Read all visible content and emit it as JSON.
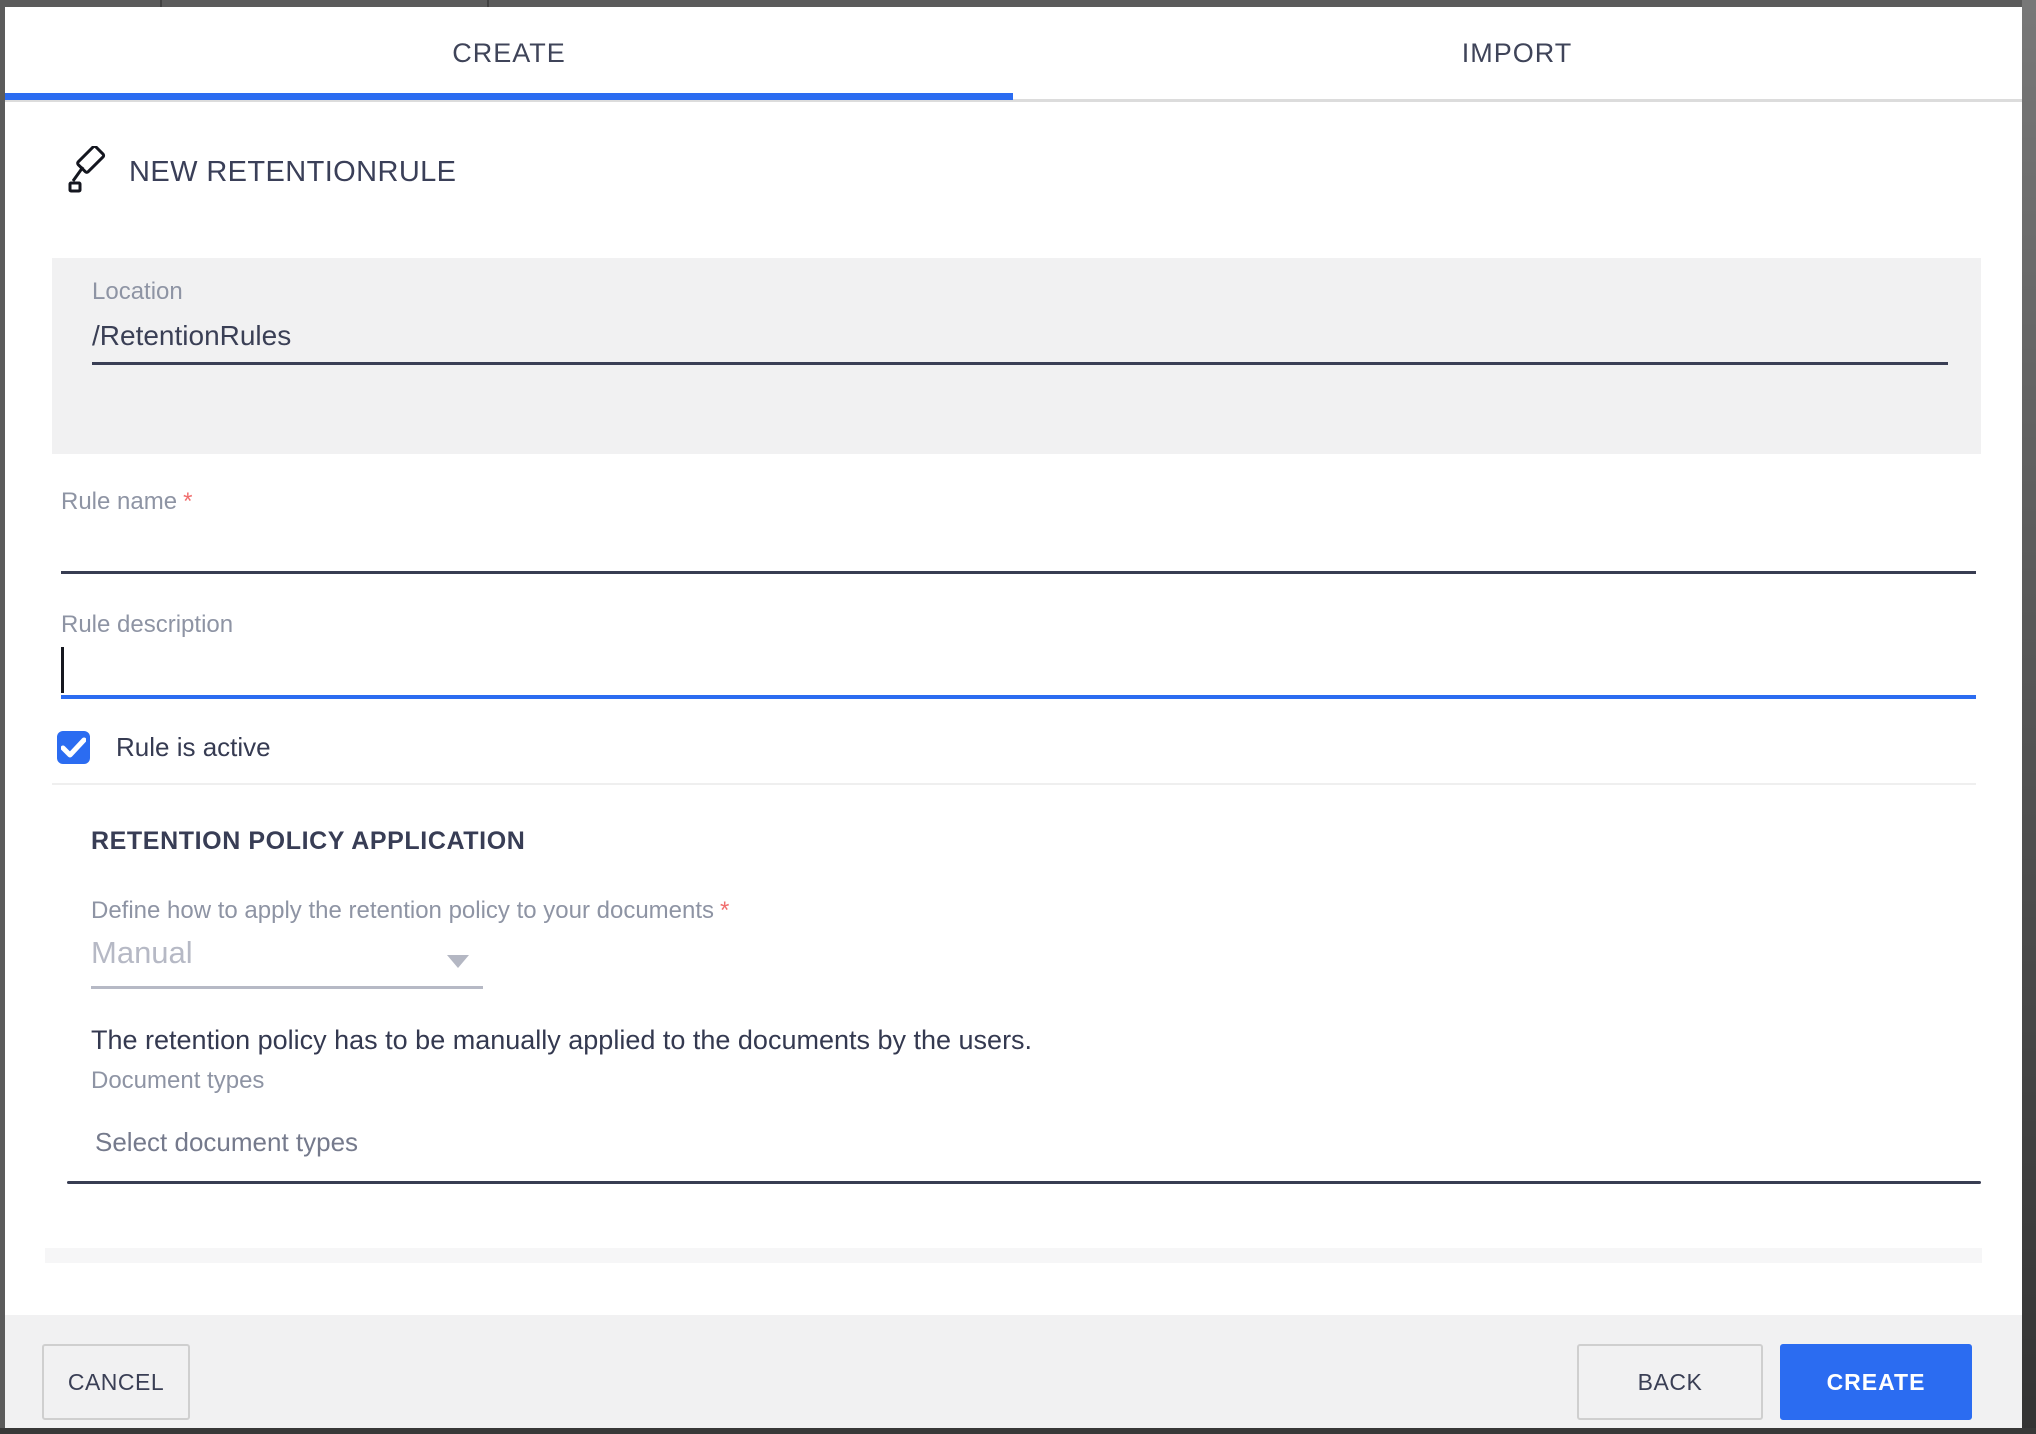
{
  "tabs": [
    {
      "label": "CREATE",
      "active": true
    },
    {
      "label": "IMPORT",
      "active": false
    }
  ],
  "header": {
    "title": "NEW RETENTIONRULE",
    "icon": "gavel-icon"
  },
  "location": {
    "label": "Location",
    "value": "/RetentionRules"
  },
  "fields": {
    "required_mark": "*",
    "rule_name": {
      "label": "Rule name",
      "required": true,
      "value": ""
    },
    "rule_description": {
      "label": "Rule description",
      "value": "",
      "focused": true
    },
    "rule_active": {
      "label": "Rule is active",
      "checked": true
    }
  },
  "retention_section": {
    "title": "RETENTION POLICY APPLICATION",
    "apply_label": "Define how to apply the retention policy to your documents",
    "apply_required": true,
    "apply_value": "Manual",
    "apply_disabled": true,
    "apply_hint": "The retention policy has to be manually applied to the documents by the users.",
    "document_types_label": "Document types",
    "document_types_placeholder": "Select document types"
  },
  "footer": {
    "cancel_label": "CANCEL",
    "back_label": "BACK",
    "create_label": "CREATE"
  },
  "colors": {
    "accent_blue": "#2b6cf1",
    "text_dark": "#3a3f55",
    "label_gray": "#8e94a4",
    "disabled_gray": "#b6b9c5",
    "required_red": "#f06e6e",
    "footer_bg": "#f1f1f2",
    "frame_gray": "#5b5b5b"
  }
}
